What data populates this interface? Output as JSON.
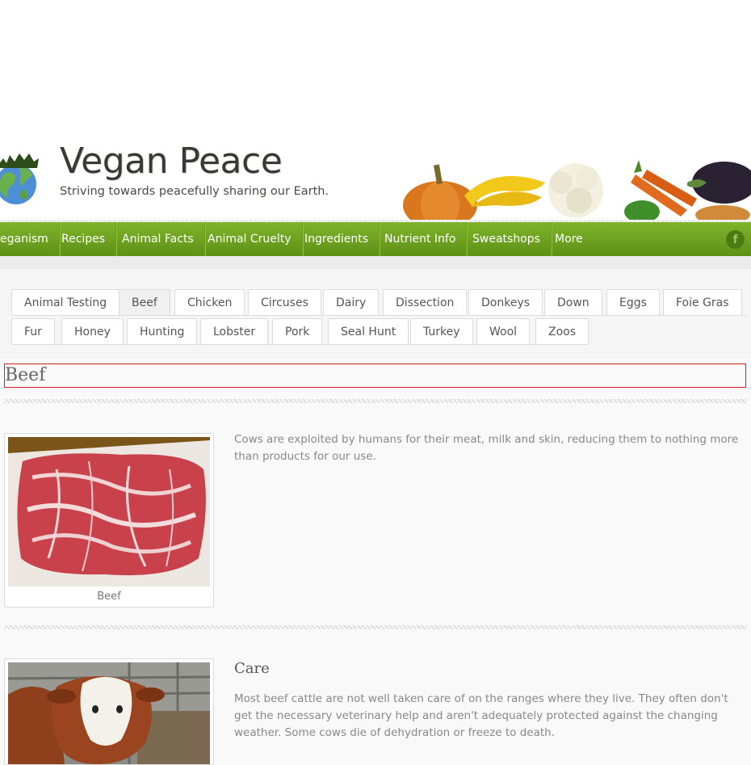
{
  "site": {
    "title": "Vegan Peace",
    "tagline": "Striving towards peacefully sharing our Earth."
  },
  "nav": {
    "items": [
      "eganism",
      "Recipes",
      "Animal Facts",
      "Animal Cruelty",
      "Ingredients",
      "Nutrient Info",
      "Sweatshops",
      "More"
    ],
    "social_icon": "facebook-icon",
    "facebook_glyph": "f"
  },
  "tabs": {
    "row1": [
      "Animal Testing",
      "Beef",
      "Chicken",
      "Circuses",
      "Dairy",
      "Dissection",
      "Donkeys",
      "Down",
      "Eggs",
      "Foie Gras"
    ],
    "row2": [
      "Fur",
      "Honey",
      "Hunting",
      "Lobster",
      "Pork",
      "Seal Hunt",
      "Turkey",
      "Wool",
      "Zoos"
    ],
    "active": "Beef"
  },
  "content": {
    "heading": "Beef",
    "intro": {
      "image_caption": "Beef",
      "text": "Cows are exploited by humans for their meat, milk and skin, reducing them to nothing more than products for our use."
    },
    "care": {
      "title": "Care",
      "text": "Most beef cattle are not well taken care of on the ranges where they live. They often don't get the necessary veterinary help and aren't adequately protected against the changing weather. Some cows die of dehydration or freeze to death."
    }
  },
  "colors": {
    "nav_green": "#6ea321",
    "heading_outline": "#cc2222"
  }
}
